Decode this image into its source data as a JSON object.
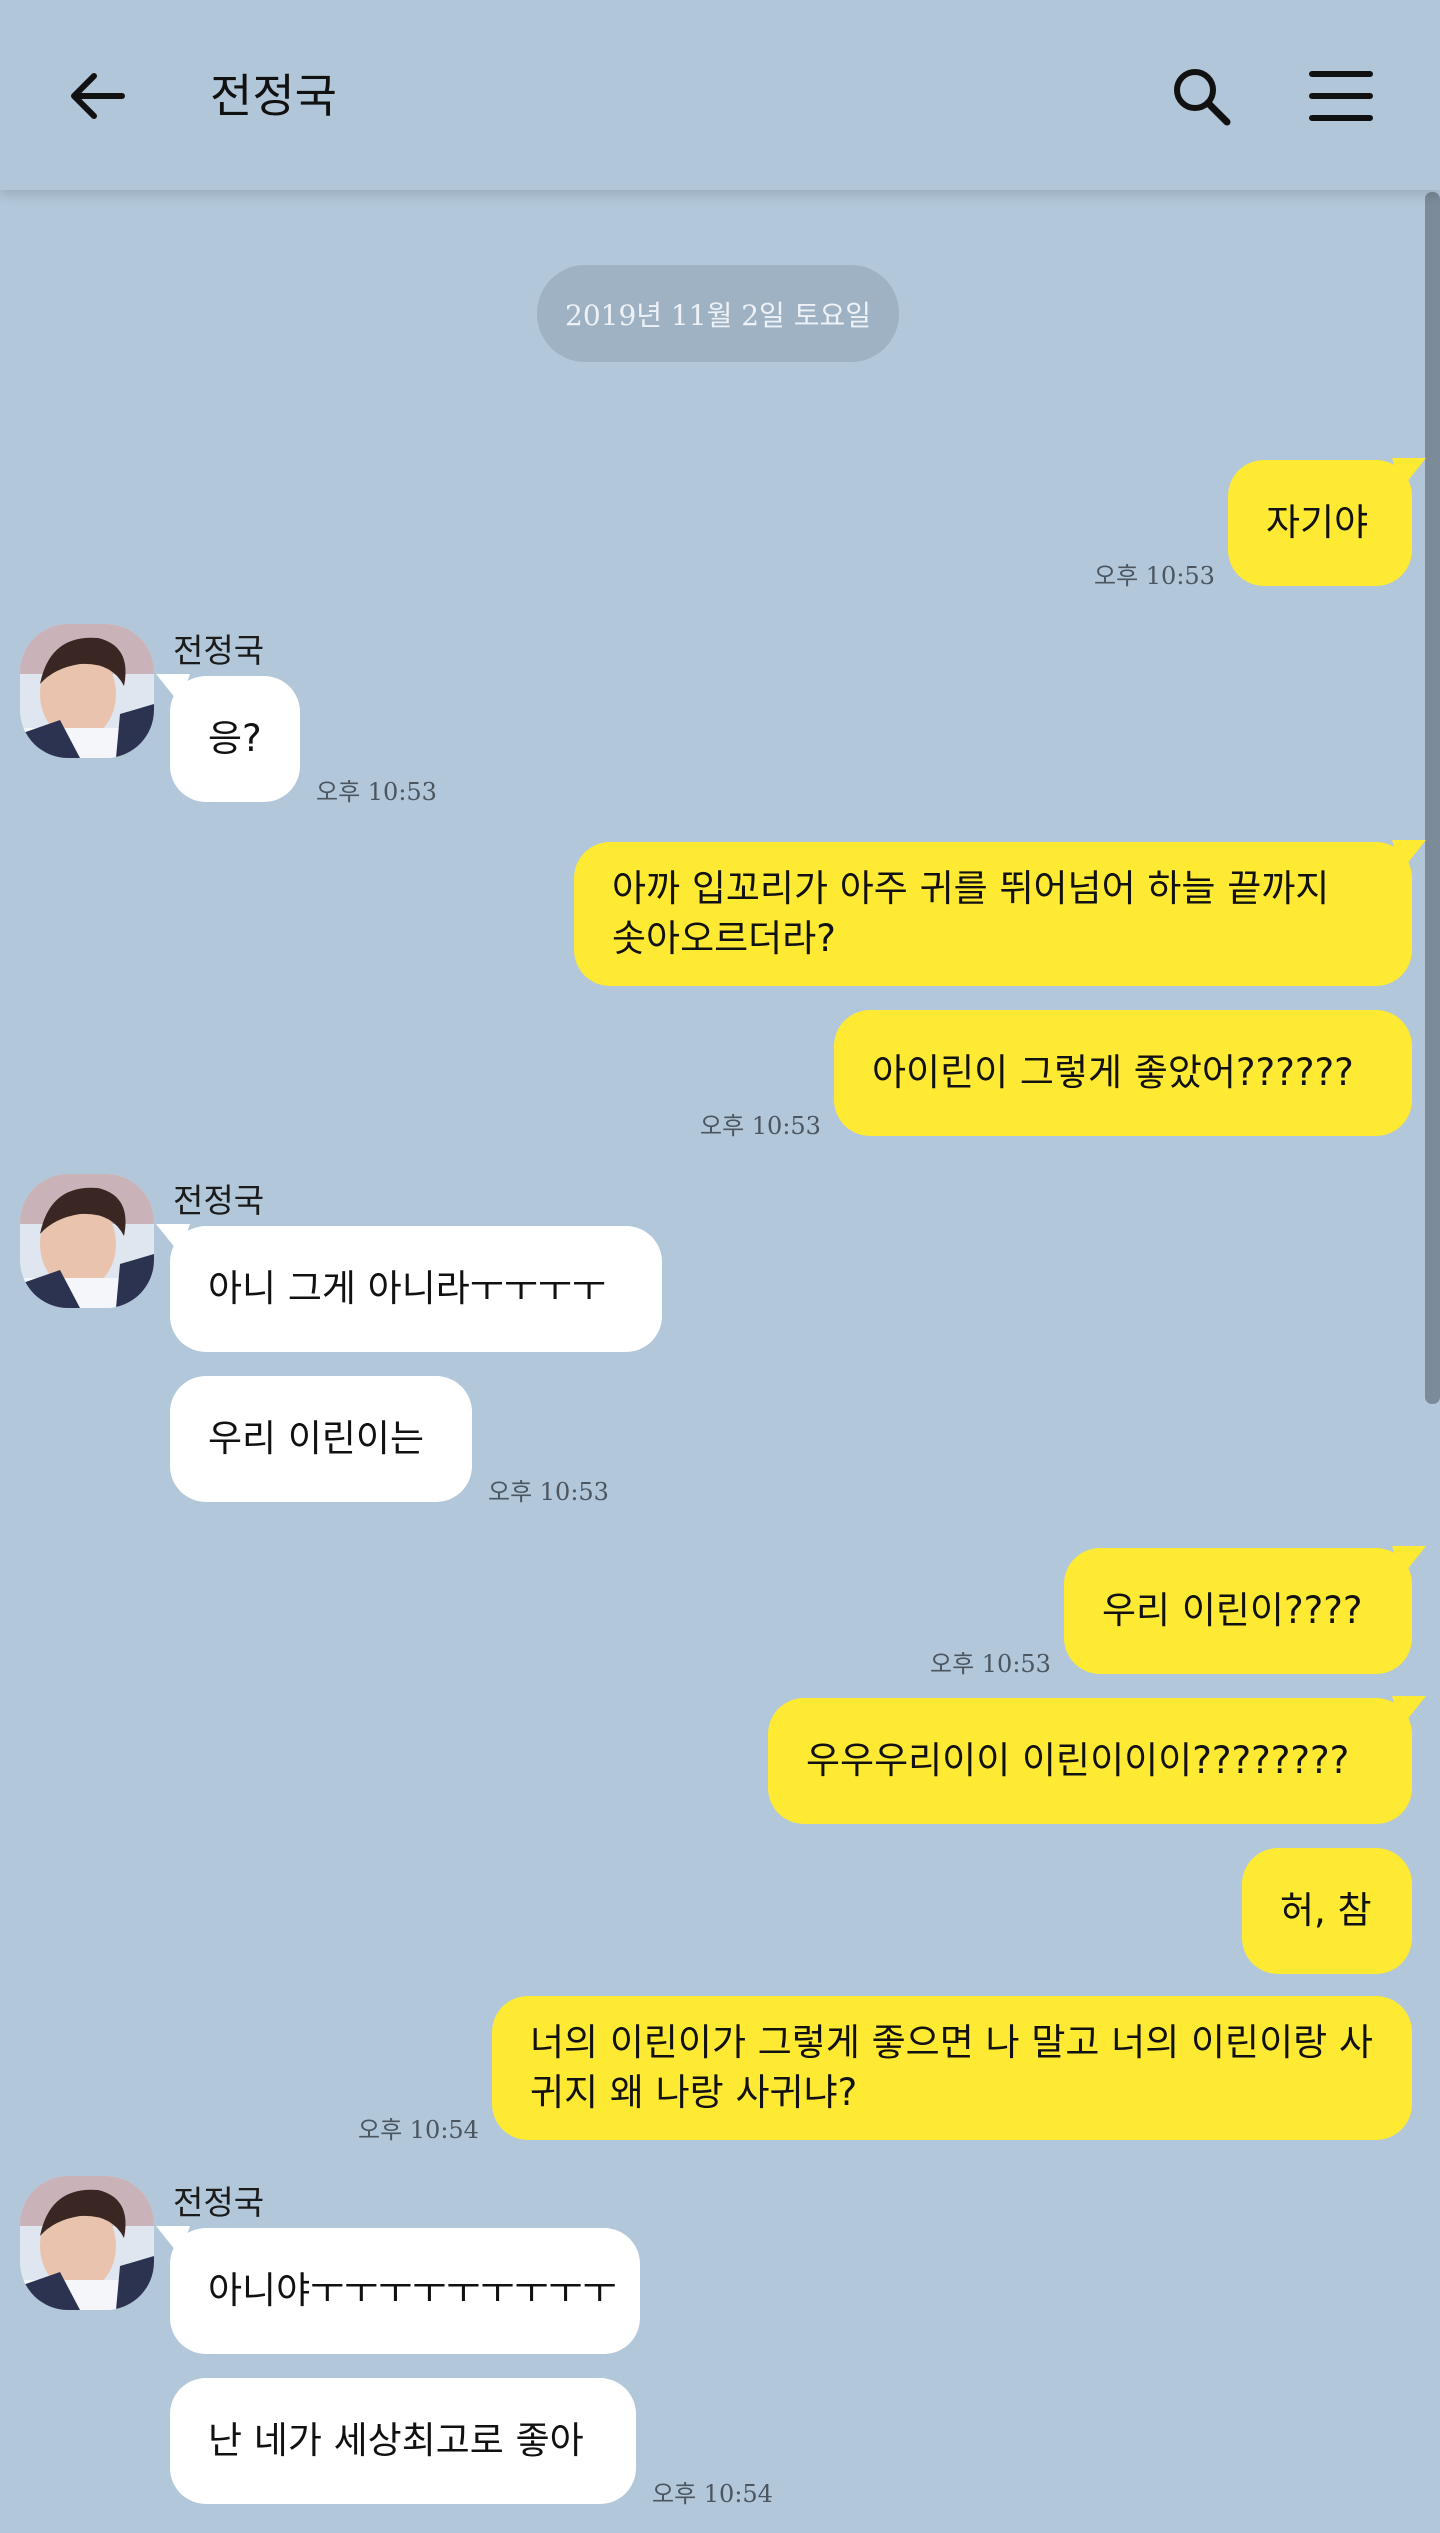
{
  "header": {
    "title": "전정국"
  },
  "date_divider": "2019년 11월 2일 토요일",
  "messages": [
    {
      "side": "me",
      "text": "자기야",
      "time": "오후 10:53"
    },
    {
      "side": "them",
      "sender": "전정국",
      "text": "응?",
      "time": "오후 10:53"
    },
    {
      "side": "me",
      "text": "아까 입꼬리가 아주 귀를 뛰어넘어 하늘 끝까지 솟아오르더라?"
    },
    {
      "side": "me",
      "text": "아이린이 그렇게 좋았어??????",
      "time": "오후 10:53"
    },
    {
      "side": "them",
      "sender": "전정국",
      "text": "아니 그게 아니라ㅜㅜㅜㅜ"
    },
    {
      "side": "them",
      "text": "우리 이린이는",
      "time": "오후 10:53"
    },
    {
      "side": "me",
      "text": "우리 이린이????",
      "time": "오후 10:53"
    },
    {
      "side": "me",
      "text": "우우우리이이 이린이이이????????"
    },
    {
      "side": "me",
      "text": "허, 참"
    },
    {
      "side": "me",
      "text": "너의 이린이가 그렇게 좋으면 나 말고 너의 이린이랑 사귀지 왜 나랑 사귀냐?",
      "time": "오후 10:54"
    },
    {
      "side": "them",
      "sender": "전정국",
      "text": "아니야ㅜㅜㅜㅜㅜㅜㅜㅜㅜ"
    },
    {
      "side": "them",
      "text": "난 네가 세상최고로 좋아",
      "time": "오후 10:54"
    }
  ],
  "colors": {
    "background": "#b2c7da",
    "my_bubble": "#fee933",
    "their_bubble": "#ffffff"
  },
  "icons": [
    "back-arrow-icon",
    "search-icon",
    "menu-icon"
  ]
}
